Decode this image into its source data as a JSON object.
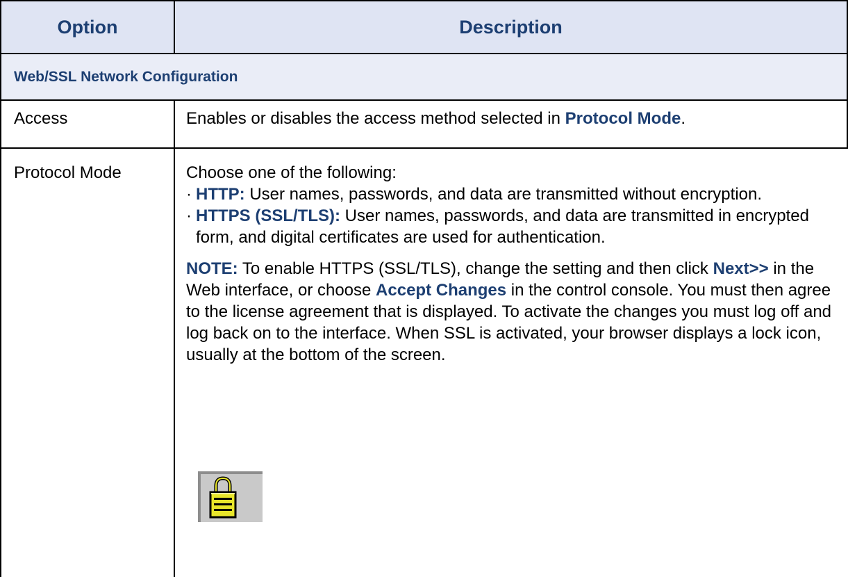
{
  "header": {
    "option": "Option",
    "description": "Description"
  },
  "section_title": "Web/SSL Network Configuration",
  "rows": [
    {
      "option": "Access",
      "desc_prefix": "Enables or disables the access method selected in ",
      "desc_link": "Protocol Mode",
      "desc_suffix": "."
    },
    {
      "option": "Protocol Mode",
      "intro": "Choose one of the following:",
      "bullets": [
        {
          "term": "HTTP:",
          "text": " User names, passwords, and data are transmitted without encryption."
        },
        {
          "term": "HTTPS (SSL/TLS):",
          "text": " User names, passwords, and data are transmitted in encrypted form, and digital certificates are used for authentication."
        }
      ],
      "note": {
        "label": "NOTE:",
        "text1": " To enable HTTPS (SSL/TLS), change the setting and then click ",
        "next": "Next>>",
        "text2": " in the Web interface, or choose ",
        "accept": "Accept Changes",
        "text3": " in the control console. You must then agree to the license agreement that is displayed. To activate the changes you must log off and log back on to the interface. When SSL is activated, your browser displays a lock icon, usually at the bottom of the screen."
      },
      "icon": "lock-icon"
    }
  ],
  "colors": {
    "accent": "#1d3f72",
    "header_bg": "#dfe4f3",
    "section_bg": "#eaedf7",
    "lock_body": "#e8e62a"
  }
}
